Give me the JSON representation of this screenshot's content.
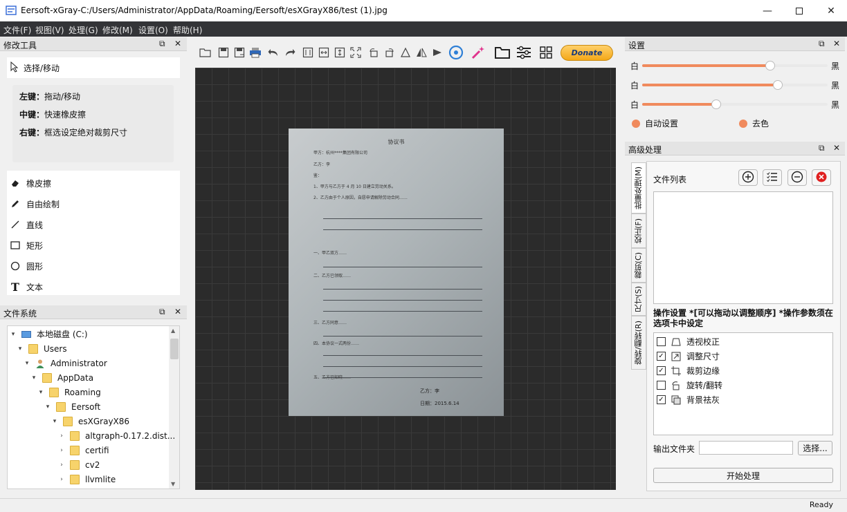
{
  "window": {
    "title": "Eersoft-xGray-C:/Users/Administrator/AppData/Roaming/Eersoft/esXGrayX86/test (1).jpg"
  },
  "menu": [
    "文件(F)",
    "视图(V)",
    "处理(G)",
    "修改(M)",
    "设置(O)",
    "帮助(H)"
  ],
  "left_tools": {
    "title": "修改工具",
    "select_label": "选择/移动",
    "hints": [
      {
        "key": "左键：",
        "text": "拖动/移动"
      },
      {
        "key": "中键：",
        "text": "快速橡皮擦"
      },
      {
        "key": "右键：",
        "text": "框选设定绝对裁剪尺寸"
      }
    ],
    "tools": [
      "橡皮擦",
      "自由绘制",
      "直线",
      "矩形",
      "圆形",
      "文本"
    ]
  },
  "filesystem": {
    "title": "文件系统",
    "items": [
      "本地磁盘 (C:)",
      "Users",
      "Administrator",
      "AppData",
      "Roaming",
      "Eersoft",
      "esXGrayX86",
      "altgraph-0.17.2.dist...",
      "certifi",
      "cv2",
      "llvmlite"
    ]
  },
  "toolbar": {
    "donate_label": "Donate"
  },
  "settings": {
    "title": "设置",
    "sliders": [
      {
        "left": "白",
        "right": "黑",
        "value": 0.69
      },
      {
        "left": "白",
        "right": "黑",
        "value": 0.73
      },
      {
        "left": "白",
        "right": "黑",
        "value": 0.4
      }
    ],
    "auto_label": "自动设置",
    "decolor_label": "去色",
    "accent": "#f08a5d"
  },
  "advanced": {
    "title": "高级处理",
    "tabs": [
      "批量处理(M)",
      "校正(F)",
      "裁剪(C)",
      "尺寸(S)",
      "旋转/翻转(R)"
    ],
    "file_list_label": "文件列表",
    "op_note": "操作设置 *[可以拖动以调整顺序] *操作参数须在选项卡中设定",
    "operations": [
      {
        "label": "透视校正",
        "checked": false
      },
      {
        "label": "调整尺寸",
        "checked": true
      },
      {
        "label": "裁剪边缘",
        "checked": true
      },
      {
        "label": "旋转/翻转",
        "checked": false
      },
      {
        "label": "背景祛灰",
        "checked": true
      }
    ],
    "output_label": "输出文件夹",
    "browse_label": "选择...",
    "start_label": "开始处理"
  },
  "status": {
    "text": "Ready"
  },
  "document": {
    "title": "协议书",
    "lines": [
      "甲方：杭州****集团有限公司",
      "乙方：李",
      "鉴：",
      "1、甲方与乙方于 4 月 10 日建立劳动关系。",
      "2、乙方由于个人原因，自愿申请解除劳动合同……",
      "一、甲乙双方……",
      "二、乙方已领取……",
      "三、乙方同意……",
      "四、本协议一式两份……",
      "五、乙方已知晓……",
      "乙方：李",
      "日期：2015.6.14"
    ]
  }
}
